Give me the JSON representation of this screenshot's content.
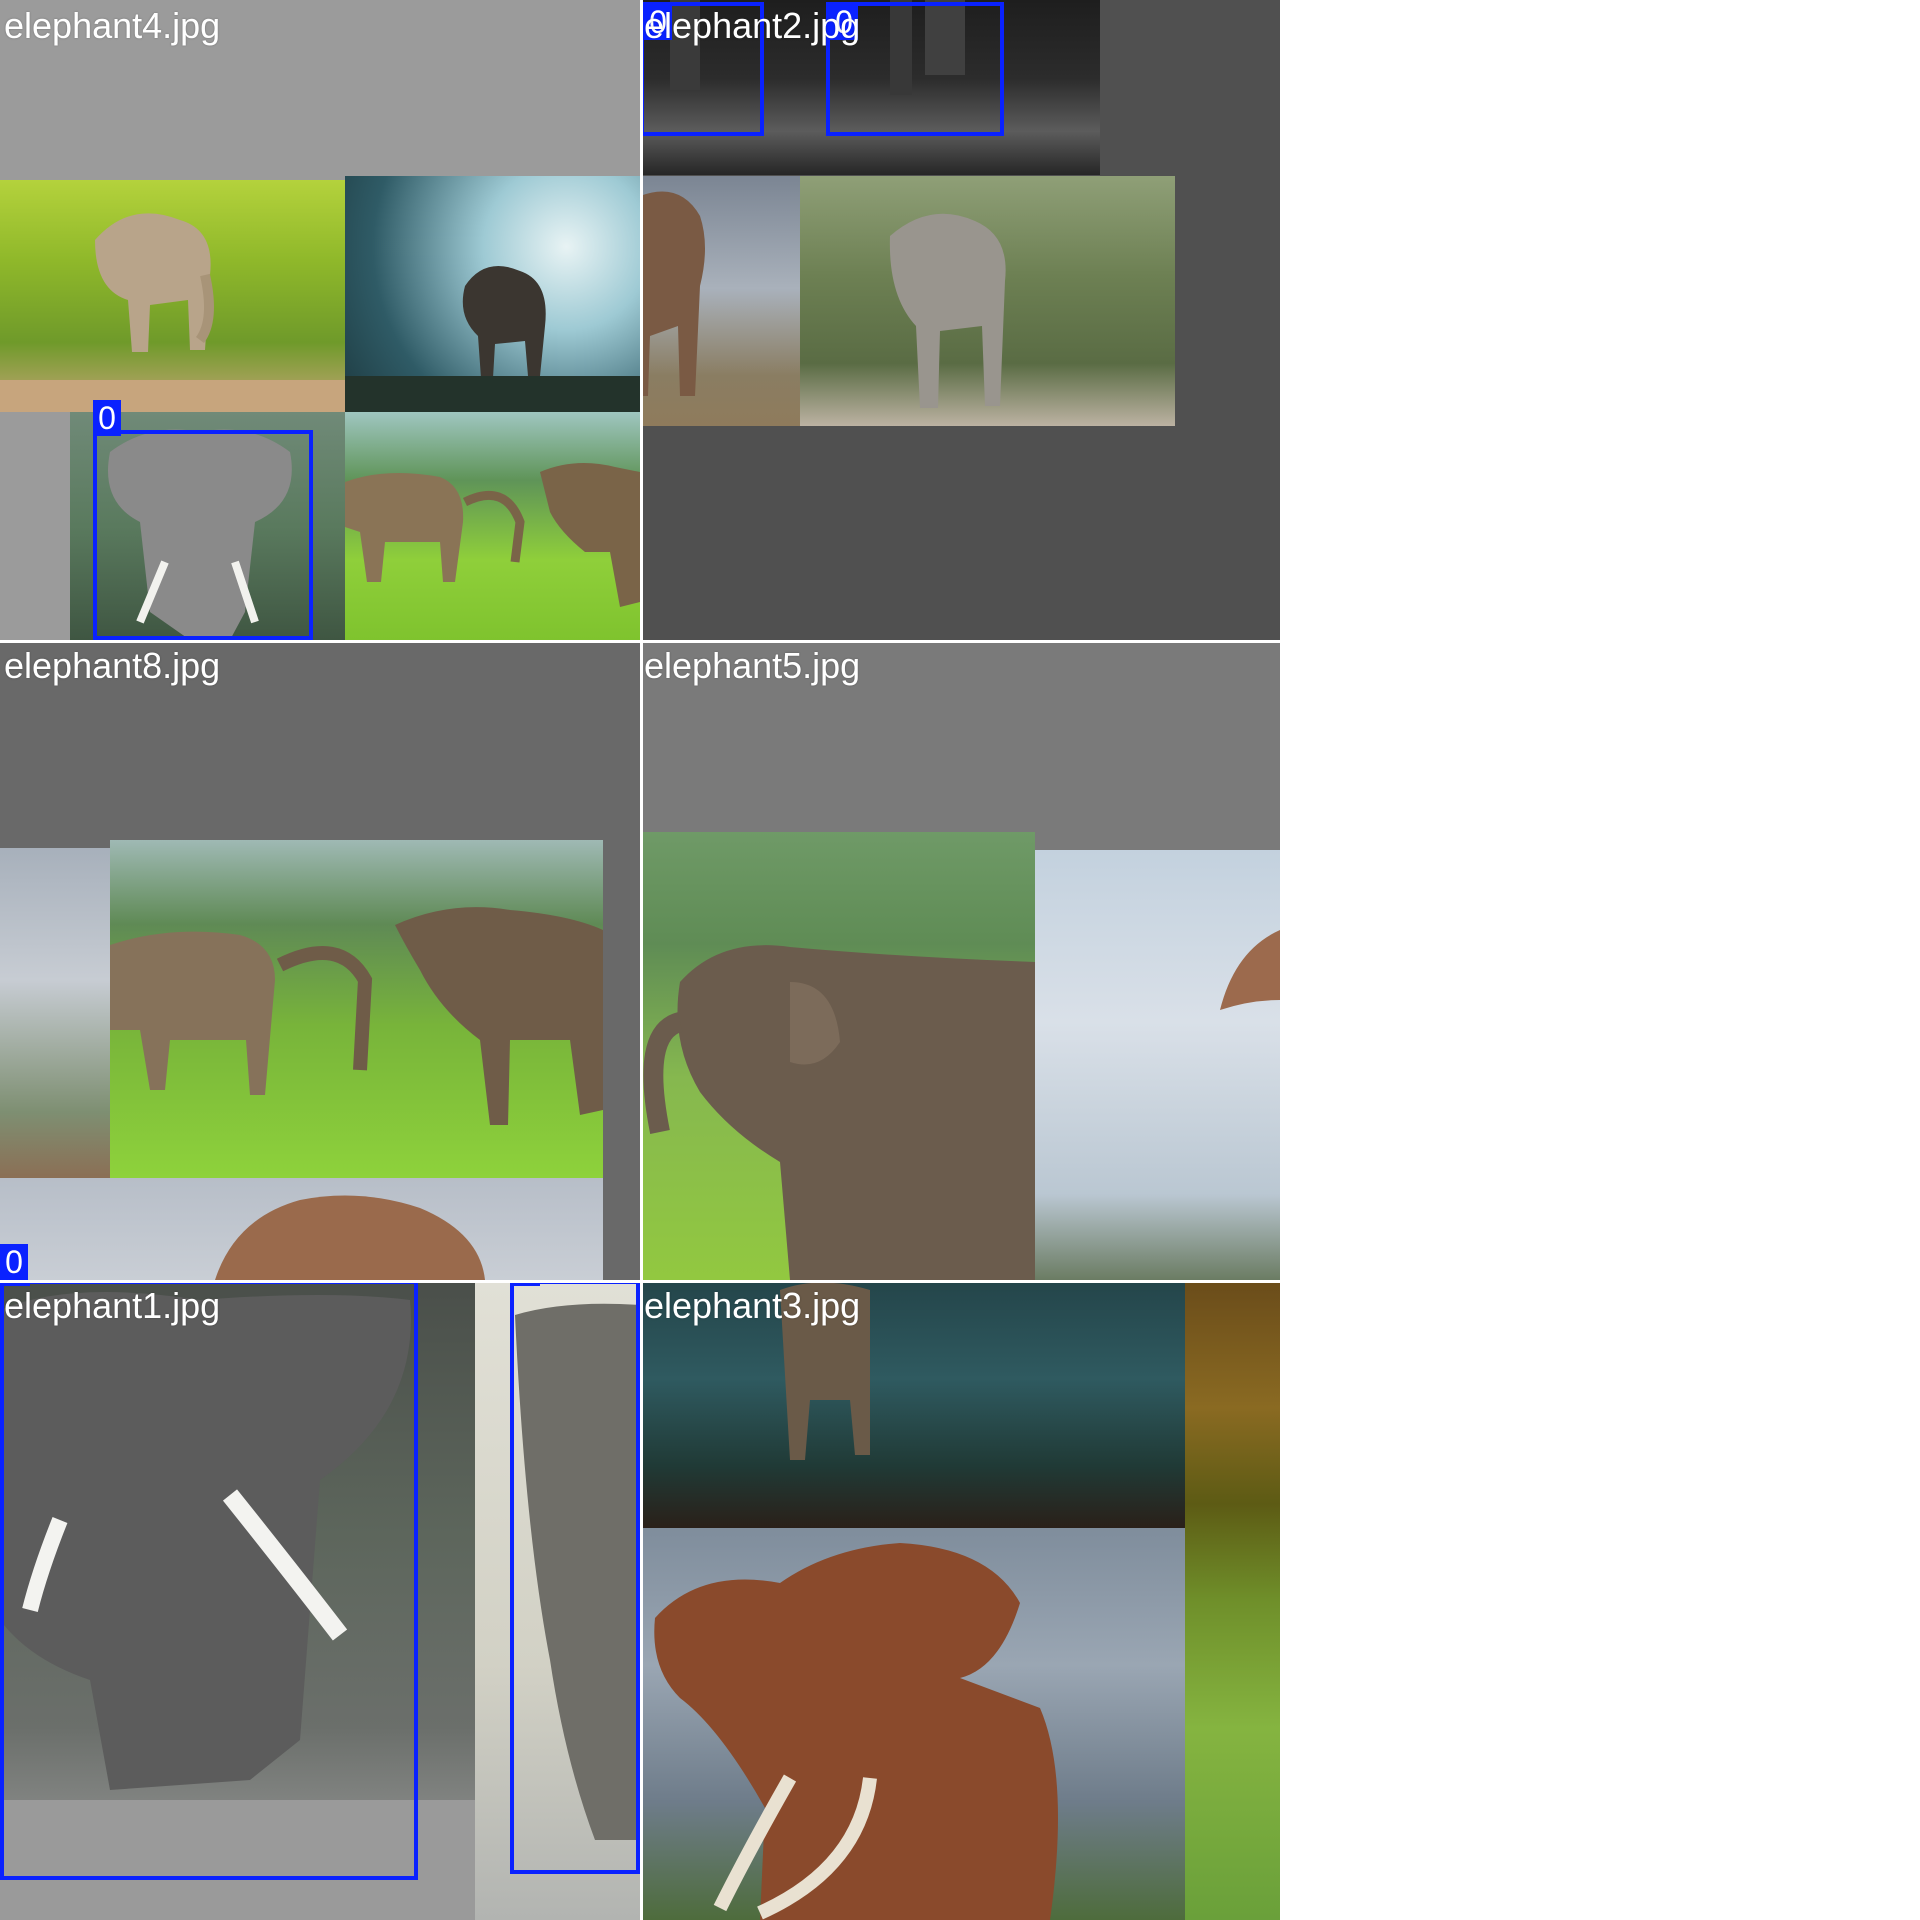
{
  "tiles": [
    {
      "filename": "elephant4.jpg"
    },
    {
      "filename": "elephant2.jpg"
    },
    {
      "filename": "elephant8.jpg"
    },
    {
      "filename": "elephant5.jpg"
    },
    {
      "filename": "elephant1.jpg"
    },
    {
      "filename": "elephant3.jpg"
    }
  ],
  "detection_label": "0",
  "colors": {
    "box": "#0a22ff",
    "pad_gray_light": "#9b9b9b",
    "pad_gray_dark": "#505050",
    "pad_gray_mid": "#7a7a7a",
    "pad_gray_dim": "#696969"
  }
}
